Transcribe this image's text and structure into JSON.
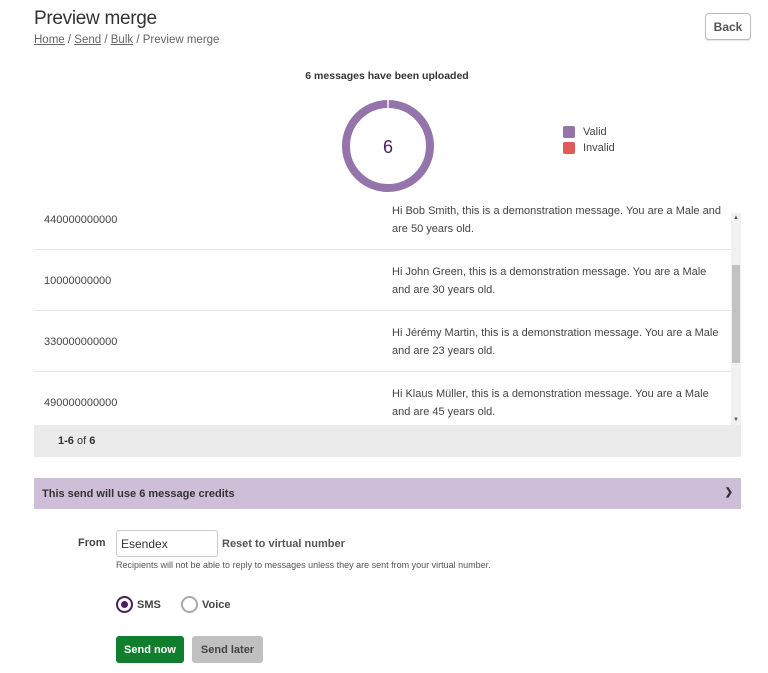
{
  "header": {
    "title": "Preview merge",
    "back_label": "Back",
    "breadcrumb": [
      {
        "label": "Home"
      },
      {
        "label": "Send"
      },
      {
        "label": "Bulk"
      },
      {
        "label": "Preview merge"
      }
    ],
    "separator": "/"
  },
  "summary": {
    "heading": "6 messages have been uploaded",
    "total": "6",
    "chart": {
      "type": "pie",
      "categories": [
        "Valid",
        "Invalid"
      ],
      "values": [
        6,
        0
      ],
      "colors": [
        "#9474aa",
        "#e05a5a"
      ]
    }
  },
  "legend": [
    {
      "label": "Valid",
      "color": "#9474aa"
    },
    {
      "label": "Invalid",
      "color": "#e05a5a"
    }
  ],
  "rows": [
    {
      "number": "440000000000",
      "message": "Hi Bob Smith, this is a demonstration message. You are a Male and are 50 years old."
    },
    {
      "number": "10000000000",
      "message": "Hi John Green, this is a demonstration message. You are a Male and are 30 years old."
    },
    {
      "number": "330000000000",
      "message": "Hi Jérémy Martin, this is a demonstration message. You are a Male and are 23 years old."
    },
    {
      "number": "490000000000",
      "message": "Hi Klaus Müller, this is a demonstration message. You are a Male and are 45 years old."
    }
  ],
  "pager": {
    "range": "1-6",
    "of": "of",
    "total": "6"
  },
  "credits": {
    "label": "This send will use 6 message credits"
  },
  "form": {
    "from_label": "From",
    "from_value": "Esendex",
    "reset_label": "Reset to virtual number",
    "hint": "Recipients will not be able to reply to messages unless they are sent from your virtual number.",
    "channels": [
      {
        "label": "SMS",
        "selected": true
      },
      {
        "label": "Voice",
        "selected": false
      }
    ],
    "send_now": "Send now",
    "send_later": "Send later"
  }
}
